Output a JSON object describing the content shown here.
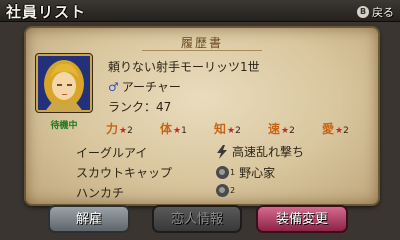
{
  "header": {
    "title": "社員リスト",
    "back_key": "B",
    "back_label": "戻る"
  },
  "resume": {
    "title": "履歴書",
    "name": "頼りない射手モーリッツ1世",
    "gender_icon": "male-symbol-icon",
    "gender_symbol": "♂",
    "class": "アーチャー",
    "rank": "ランク：47",
    "status": "待機中"
  },
  "stats": [
    {
      "label": "力",
      "mark": "★",
      "value": "2"
    },
    {
      "label": "体",
      "mark": "★",
      "value": "1"
    },
    {
      "label": "知",
      "mark": "★",
      "value": "2"
    },
    {
      "label": "速",
      "mark": "★",
      "value": "2"
    },
    {
      "label": "愛",
      "mark": "★",
      "value": "2"
    }
  ],
  "skills": {
    "left": [
      "イーグルアイ",
      "スカウトキャップ",
      "ハンカチ"
    ],
    "right": [
      {
        "icon": "lightning-bolt-icon",
        "label": "高速乱れ撃ち"
      },
      {
        "icon": "head-icon",
        "badge": "1",
        "label": "野心家"
      },
      {
        "icon": "head-icon",
        "badge": "2",
        "label": ""
      }
    ]
  },
  "buttons": {
    "fire": "解雇",
    "love": "恋人情報",
    "equip": "装備変更"
  },
  "colors": {
    "parchment": "#e2d2ad",
    "stat_label": "#c86418",
    "equip_button": "#c04a72"
  }
}
